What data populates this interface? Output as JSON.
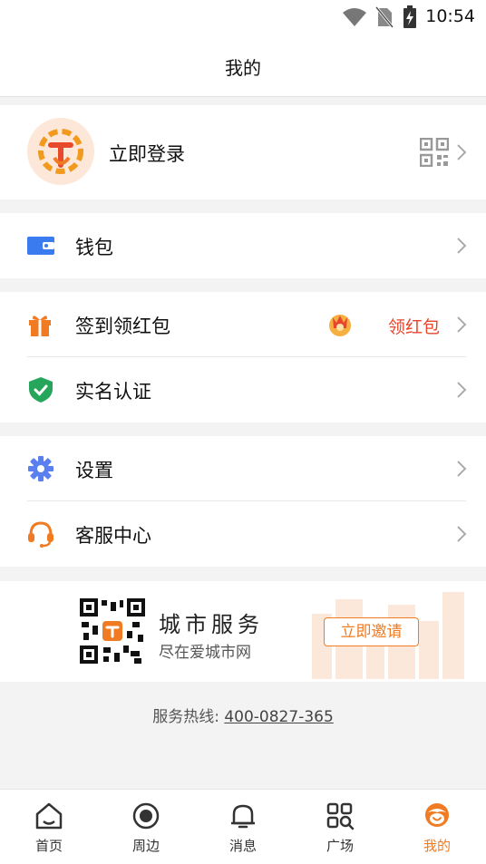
{
  "status_bar": {
    "time": "10:54",
    "icons": [
      "wifi-icon",
      "no-sim-icon",
      "battery-charging-icon"
    ]
  },
  "header": {
    "title": "我的"
  },
  "profile": {
    "login_label": "立即登录",
    "avatar_icon": "app-logo-icon",
    "qr_icon": "qr-code-icon"
  },
  "menu": {
    "wallet": {
      "label": "钱包",
      "icon": "wallet-icon"
    },
    "checkin": {
      "label": "签到领红包",
      "badge": "领红包",
      "icon": "gift-icon",
      "badge_icon": "red-envelope-icon"
    },
    "realname": {
      "label": "实名认证",
      "icon": "shield-check-icon"
    },
    "settings": {
      "label": "设置",
      "icon": "gear-icon"
    },
    "service": {
      "label": "客服中心",
      "icon": "headset-icon"
    }
  },
  "promo": {
    "title": "城市服务",
    "subtitle": "尽在爱城市网",
    "button": "立即邀请",
    "qr_icon": "promo-qr-code-icon"
  },
  "hotline": {
    "label": "服务热线: ",
    "number": "400-0827-365"
  },
  "bottom_nav": [
    {
      "label": "首页",
      "icon": "home-icon",
      "active": false
    },
    {
      "label": "周边",
      "icon": "nearby-icon",
      "active": false
    },
    {
      "label": "消息",
      "icon": "bell-icon",
      "active": false
    },
    {
      "label": "广场",
      "icon": "square-apps-icon",
      "active": false
    },
    {
      "label": "我的",
      "icon": "profile-face-icon",
      "active": true
    }
  ],
  "colors": {
    "accent": "#f07b23",
    "badge_red": "#e8452c",
    "wallet_blue": "#3a7bf0",
    "shield_green": "#26a65b",
    "gear_blue": "#5a7ff0"
  }
}
